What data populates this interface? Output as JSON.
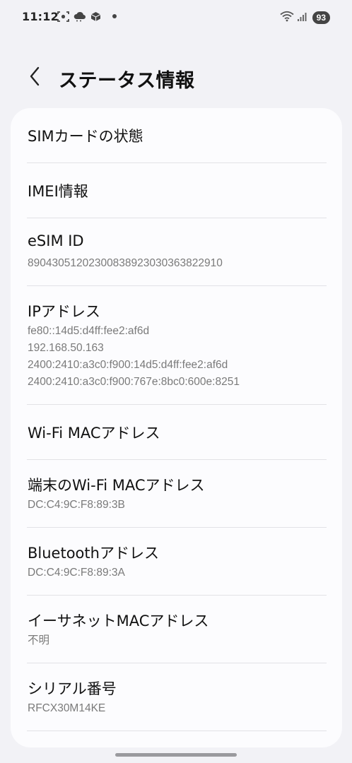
{
  "status_bar": {
    "time": "11:12",
    "battery": "93",
    "icons": [
      "screenshot-icon",
      "cloud-icon",
      "cube-icon",
      "notification-dot",
      "wifi-icon",
      "signal-icon",
      "battery-icon"
    ]
  },
  "header": {
    "title": "ステータス情報",
    "back_icon": "chevron-left-icon"
  },
  "items": [
    {
      "title": "SIMカードの状態",
      "subtitle_lines": []
    },
    {
      "title": "IMEI情報",
      "subtitle_lines": []
    },
    {
      "title": "eSIM ID",
      "subtitle_lines": [
        "89043051202300838923030363822910"
      ]
    },
    {
      "title": "IPアドレス",
      "subtitle_lines": [
        "fe80::14d5:d4ff:fee2:af6d",
        "192.168.50.163",
        "2400:2410:a3c0:f900:14d5:d4ff:fee2:af6d",
        "2400:2410:a3c0:f900:767e:8bc0:600e:8251"
      ]
    },
    {
      "title": "Wi-Fi MACアドレス",
      "subtitle_lines": []
    },
    {
      "title": "端末のWi-Fi MACアドレス",
      "subtitle_lines": [
        "DC:C4:9C:F8:89:3B"
      ]
    },
    {
      "title": "Bluetoothアドレス",
      "subtitle_lines": [
        "DC:C4:9C:F8:89:3A"
      ]
    },
    {
      "title": "イーサネットMACアドレス",
      "subtitle_lines": [
        "不明"
      ]
    },
    {
      "title": "シリアル番号",
      "subtitle_lines": [
        "RFCX30M14KE"
      ]
    }
  ],
  "colors": {
    "background": "#f2f2f6",
    "card": "#fcfcfe",
    "title_text": "#111111",
    "subtitle_text": "#7a7a7a",
    "divider": "#e2e2e6"
  }
}
